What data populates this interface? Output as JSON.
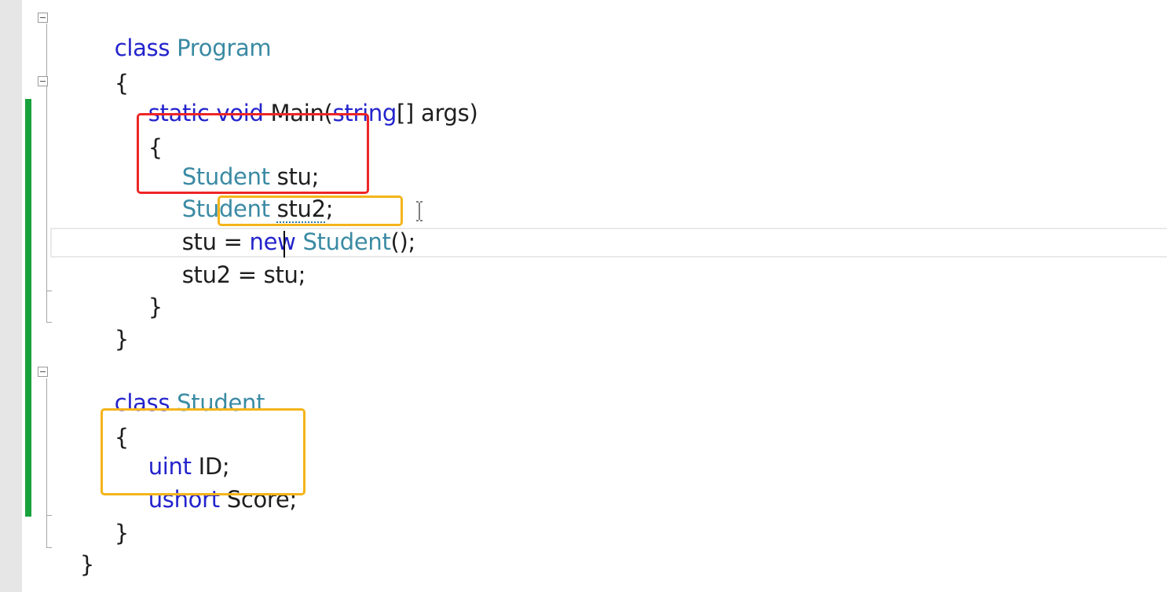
{
  "editor": {
    "language": "C#",
    "colors": {
      "keyword": "#2323cc",
      "type": "#3a8aa3",
      "text": "#1e1e1e",
      "change_bar": "#18a23c",
      "highlight_red": "#ee2626",
      "highlight_orange": "#f4b41a"
    },
    "lines": [
      {
        "tokens": [
          "class",
          " ",
          "Program"
        ]
      },
      {
        "tokens": [
          "{"
        ]
      },
      {
        "tokens": [
          "static",
          " ",
          "void",
          " Main(",
          "string",
          "[] args)"
        ]
      },
      {
        "tokens": [
          "{"
        ]
      },
      {
        "tokens": [
          "Student",
          " stu;"
        ]
      },
      {
        "tokens": [
          "Student",
          " ",
          "stu2",
          ";"
        ]
      },
      {
        "tokens": [
          "stu = ",
          "new",
          " ",
          "Student",
          "();"
        ]
      },
      {
        "tokens": [
          "stu2 = stu;"
        ]
      },
      {
        "tokens": [
          "}"
        ]
      },
      {
        "tokens": [
          "}"
        ]
      },
      {
        "tokens": [
          "class",
          " ",
          "Student"
        ]
      },
      {
        "tokens": [
          "{"
        ]
      },
      {
        "tokens": [
          "uint",
          " ID;"
        ]
      },
      {
        "tokens": [
          "ushort",
          " Score;"
        ]
      },
      {
        "tokens": [
          "}"
        ]
      },
      {
        "tokens": [
          "}"
        ]
      }
    ],
    "fold_markers": [
      "collapse-icon",
      "collapse-icon",
      "collapse-icon"
    ],
    "annotations": [
      "red-highlight-box",
      "orange-highlight-box",
      "orange-highlight-box"
    ],
    "cursor": "text-cursor-icon"
  }
}
